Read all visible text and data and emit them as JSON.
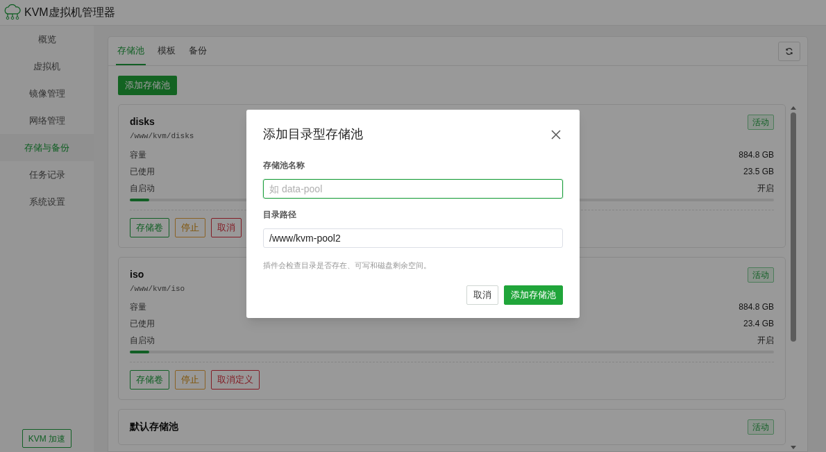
{
  "app": {
    "title": "KVM虚拟机管理器"
  },
  "sidebar": {
    "items": [
      {
        "label": "概览",
        "selected": false
      },
      {
        "label": "虚拟机",
        "selected": false
      },
      {
        "label": "镜像管理",
        "selected": false
      },
      {
        "label": "网络管理",
        "selected": false
      },
      {
        "label": "存储与备份",
        "selected": true
      },
      {
        "label": "任务记录",
        "selected": false
      },
      {
        "label": "系统设置",
        "selected": false
      }
    ],
    "footer_button": "KVM 加速"
  },
  "tabs": [
    {
      "label": "存储池",
      "selected": true
    },
    {
      "label": "模板",
      "selected": false
    },
    {
      "label": "备份",
      "selected": false
    }
  ],
  "add_button": "添加存储池",
  "pools": [
    {
      "name": "disks",
      "path": "/www/kvm/disks",
      "status": "活动",
      "stats": [
        {
          "label": "容量",
          "value": "884.8 GB"
        },
        {
          "label": "已使用",
          "value": "23.5 GB"
        },
        {
          "label": "自启动",
          "value": "开启"
        }
      ],
      "level": 0.03,
      "buttons": [
        {
          "label": "存储卷",
          "kind": "success"
        },
        {
          "label": "停止",
          "kind": "warning"
        },
        {
          "label": "取消",
          "kind": "danger"
        }
      ]
    },
    {
      "name": "iso",
      "path": "/www/kvm/iso",
      "status": "活动",
      "stats": [
        {
          "label": "容量",
          "value": "884.8 GB"
        },
        {
          "label": "已使用",
          "value": "23.4 GB"
        },
        {
          "label": "自启动",
          "value": "开启"
        }
      ],
      "level": 0.03,
      "buttons": [
        {
          "label": "存储卷",
          "kind": "success"
        },
        {
          "label": "停止",
          "kind": "warning"
        },
        {
          "label": "取消定义",
          "kind": "danger"
        }
      ]
    },
    {
      "name": "默认存储池",
      "status": "活动"
    }
  ],
  "dialog": {
    "title": "添加目录型存储池",
    "fields": [
      {
        "label": "存储池名称",
        "placeholder": "如 data-pool",
        "focused": true
      },
      {
        "label": "目录路径",
        "value": "/www/kvm-pool2",
        "focused": false
      }
    ],
    "hint": "插件会检查目录是否存在、可写和磁盘剩余空间。",
    "buttons": [
      {
        "label": "取消",
        "kind": "default"
      },
      {
        "label": "添加存储池",
        "kind": "primary"
      }
    ]
  }
}
